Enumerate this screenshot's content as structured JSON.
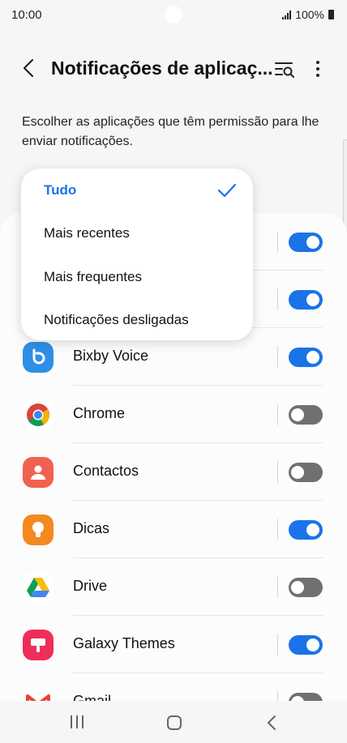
{
  "status_bar": {
    "time": "10:00",
    "battery": "100%"
  },
  "header": {
    "title": "Notificações de aplicaç..."
  },
  "description": "Escolher as aplicações que têm permissão para lhe enviar notificações.",
  "filter_menu": {
    "items": [
      {
        "label": "Tudo",
        "selected": true
      },
      {
        "label": "Mais recentes",
        "selected": false
      },
      {
        "label": "Mais frequentes",
        "selected": false
      },
      {
        "label": "Notificações desligadas",
        "selected": false
      }
    ]
  },
  "apps": [
    {
      "name": "",
      "enabled": true,
      "icon": "hidden-app-icon"
    },
    {
      "name": "",
      "enabled": true,
      "icon": "hidden-app-icon"
    },
    {
      "name": "Bixby Voice",
      "enabled": true,
      "icon": "bixby-icon"
    },
    {
      "name": "Chrome",
      "enabled": false,
      "icon": "chrome-icon"
    },
    {
      "name": "Contactos",
      "enabled": false,
      "icon": "contacts-icon"
    },
    {
      "name": "Dicas",
      "enabled": true,
      "icon": "tips-icon"
    },
    {
      "name": "Drive",
      "enabled": false,
      "icon": "drive-icon"
    },
    {
      "name": "Galaxy Themes",
      "enabled": true,
      "icon": "galaxy-themes-icon"
    },
    {
      "name": "Gmail",
      "enabled": false,
      "icon": "gmail-icon"
    }
  ],
  "colors": {
    "accent": "#1a73e8",
    "toggle_off": "#707070"
  }
}
